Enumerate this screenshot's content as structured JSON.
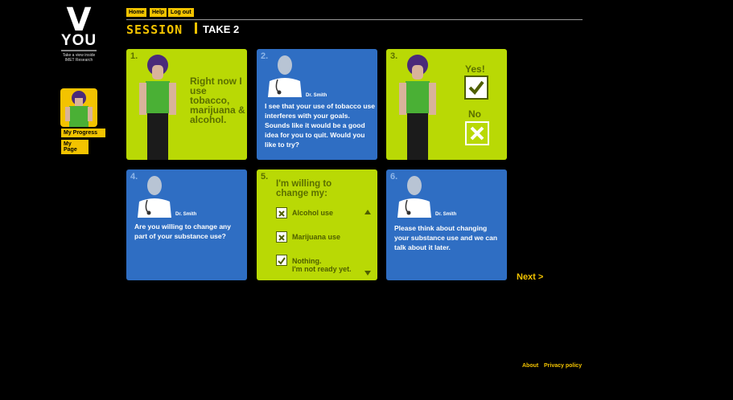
{
  "logo": {
    "letter": "V",
    "word": "YOU",
    "tagline": "Take a view inside",
    "org": "IMET Research"
  },
  "sidebar": {
    "progress_label": "My Progress",
    "mypage_label": "My Page"
  },
  "nav": {
    "home": "Home",
    "help": "Help",
    "logout": "Log out"
  },
  "session": {
    "label": "SESSION",
    "take": "TAKE 2"
  },
  "panels": [
    {
      "num": "1.",
      "text": "Right now I use tobacco, marijuana & alcohol."
    },
    {
      "num": "2.",
      "doctor": "Dr. Smith",
      "text": "I see that your use of tobacco use interferes with your goals. Sounds like it would be a good idea for you to quit. Would you like to try?"
    },
    {
      "num": "3.",
      "yes": "Yes!",
      "no": "No"
    },
    {
      "num": "4.",
      "doctor": "Dr. Smith",
      "text": "Are you willing to change any part of your substance use?"
    },
    {
      "num": "5.",
      "title": "I'm willing to change my:",
      "options": [
        "Alcohol use",
        "Marijuana use",
        "Nothing.",
        "I'm not ready yet."
      ]
    },
    {
      "num": "6.",
      "doctor": "Dr. Smith",
      "text": "Please think about changing your substance use and we can talk about it later."
    }
  ],
  "next": "Next >",
  "footer": {
    "about": "About",
    "privacy": "Privacy policy"
  },
  "colors": {
    "accent": "#f3c300",
    "green": "#b9d905",
    "blue": "#2f6ec3"
  }
}
